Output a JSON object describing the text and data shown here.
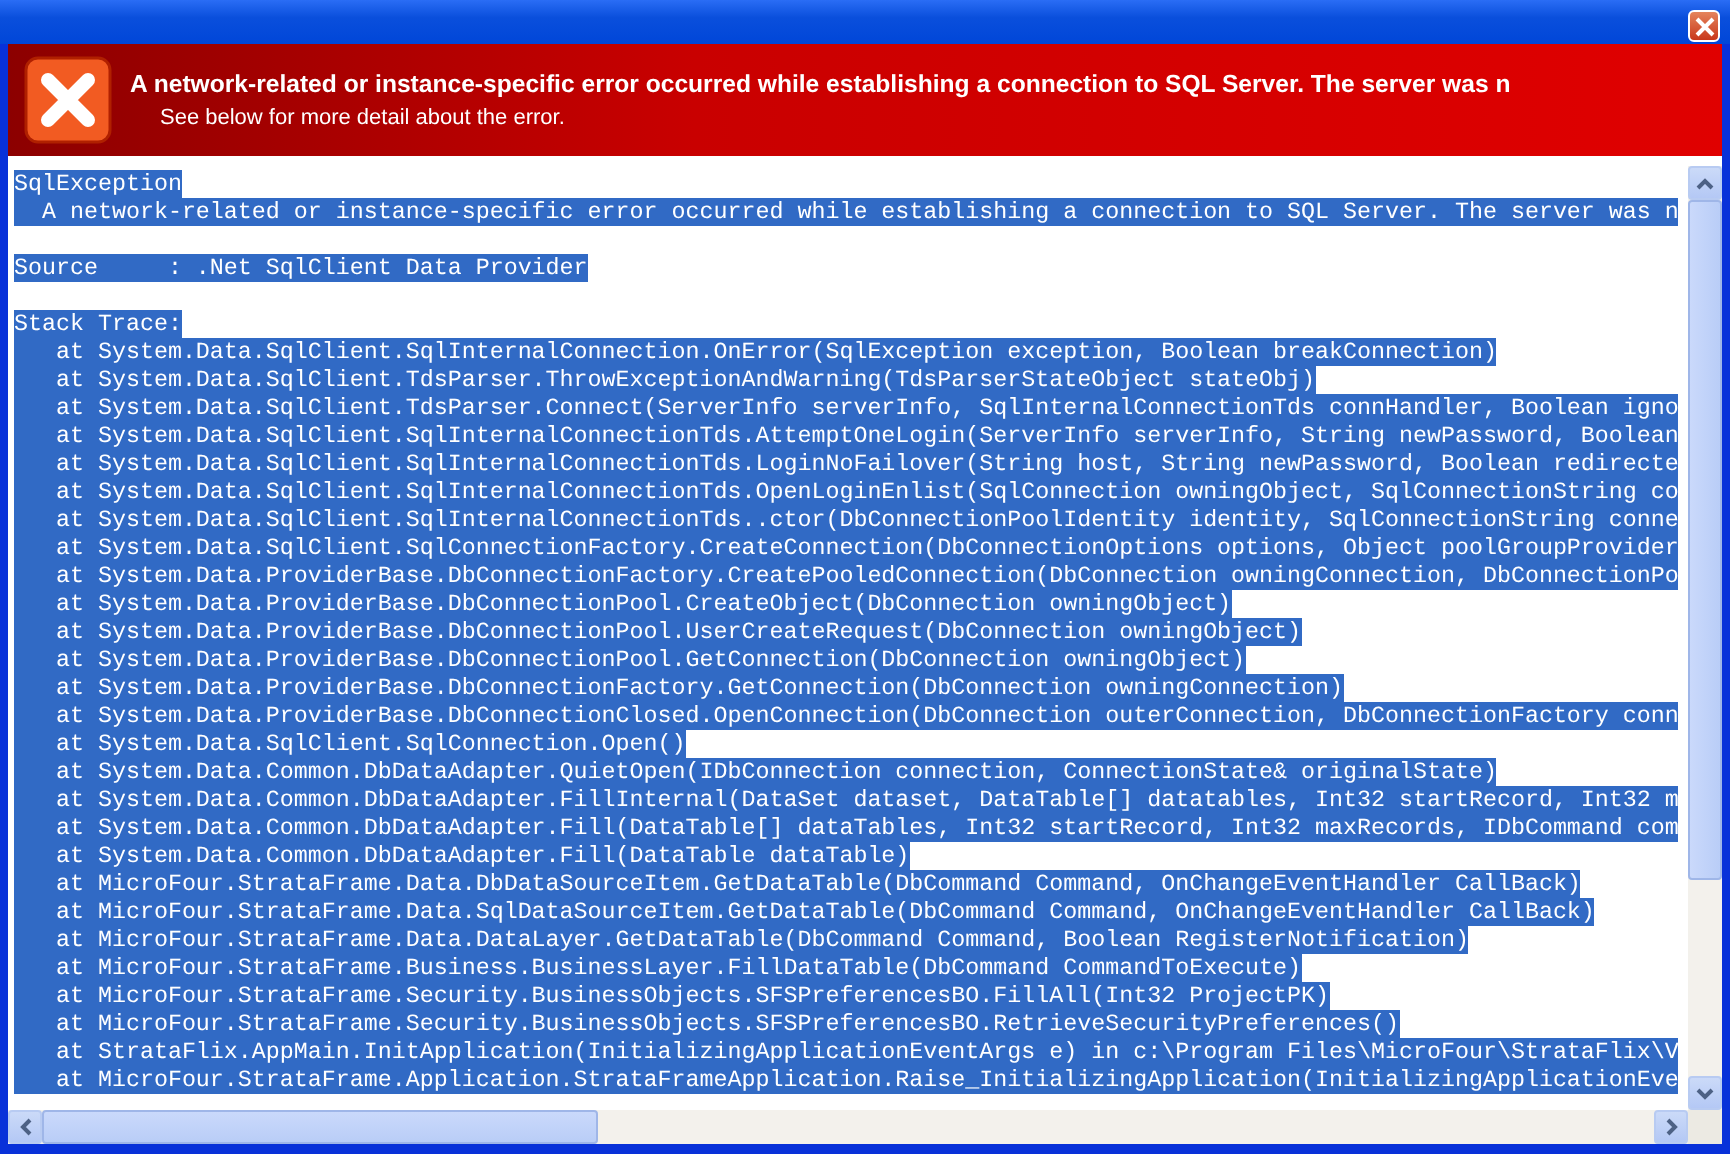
{
  "header": {
    "title": "A network-related or instance-specific error occurred while establishing a connection to SQL Server. The server was n",
    "subtitle": "See below for more detail about the error."
  },
  "details": {
    "selected": true,
    "sections": [
      {
        "lines": [
          "SqlException",
          "  A network-related or instance-specific error occurred while establishing a connection to SQL Server. The server was n"
        ]
      },
      {
        "lines": [
          "Source     : .Net SqlClient Data Provider"
        ]
      },
      {
        "lines": [
          "Stack Trace:",
          "   at System.Data.SqlClient.SqlInternalConnection.OnError(SqlException exception, Boolean breakConnection)",
          "   at System.Data.SqlClient.TdsParser.ThrowExceptionAndWarning(TdsParserStateObject stateObj)",
          "   at System.Data.SqlClient.TdsParser.Connect(ServerInfo serverInfo, SqlInternalConnectionTds connHandler, Boolean igno",
          "   at System.Data.SqlClient.SqlInternalConnectionTds.AttemptOneLogin(ServerInfo serverInfo, String newPassword, Boolean",
          "   at System.Data.SqlClient.SqlInternalConnectionTds.LoginNoFailover(String host, String newPassword, Boolean redirecte",
          "   at System.Data.SqlClient.SqlInternalConnectionTds.OpenLoginEnlist(SqlConnection owningObject, SqlConnectionString co",
          "   at System.Data.SqlClient.SqlInternalConnectionTds..ctor(DbConnectionPoolIdentity identity, SqlConnectionString conne",
          "   at System.Data.SqlClient.SqlConnectionFactory.CreateConnection(DbConnectionOptions options, Object poolGroupProvider",
          "   at System.Data.ProviderBase.DbConnectionFactory.CreatePooledConnection(DbConnection owningConnection, DbConnectionPo",
          "   at System.Data.ProviderBase.DbConnectionPool.CreateObject(DbConnection owningObject)",
          "   at System.Data.ProviderBase.DbConnectionPool.UserCreateRequest(DbConnection owningObject)",
          "   at System.Data.ProviderBase.DbConnectionPool.GetConnection(DbConnection owningObject)",
          "   at System.Data.ProviderBase.DbConnectionFactory.GetConnection(DbConnection owningConnection)",
          "   at System.Data.ProviderBase.DbConnectionClosed.OpenConnection(DbConnection outerConnection, DbConnectionFactory conn",
          "   at System.Data.SqlClient.SqlConnection.Open()",
          "   at System.Data.Common.DbDataAdapter.QuietOpen(IDbConnection connection, ConnectionState& originalState)",
          "   at System.Data.Common.DbDataAdapter.FillInternal(DataSet dataset, DataTable[] datatables, Int32 startRecord, Int32 m",
          "   at System.Data.Common.DbDataAdapter.Fill(DataTable[] dataTables, Int32 startRecord, Int32 maxRecords, IDbCommand com",
          "   at System.Data.Common.DbDataAdapter.Fill(DataTable dataTable)",
          "   at MicroFour.StrataFrame.Data.DbDataSourceItem.GetDataTable(DbCommand Command, OnChangeEventHandler CallBack)",
          "   at MicroFour.StrataFrame.Data.SqlDataSourceItem.GetDataTable(DbCommand Command, OnChangeEventHandler CallBack)",
          "   at MicroFour.StrataFrame.Data.DataLayer.GetDataTable(DbCommand Command, Boolean RegisterNotification)",
          "   at MicroFour.StrataFrame.Business.BusinessLayer.FillDataTable(DbCommand CommandToExecute)",
          "   at MicroFour.StrataFrame.Security.BusinessObjects.SFSPreferencesBO.FillAll(Int32 ProjectPK)",
          "   at MicroFour.StrataFrame.Security.BusinessObjects.SFSPreferencesBO.RetrieveSecurityPreferences()",
          "   at StrataFlix.AppMain.InitApplication(InitializingApplicationEventArgs e) in c:\\Program Files\\MicroFour\\StrataFlix\\V",
          "   at MicroFour.StrataFrame.Application.StrataFrameApplication.Raise_InitializingApplication(InitializingApplicationEve"
        ]
      }
    ]
  }
}
